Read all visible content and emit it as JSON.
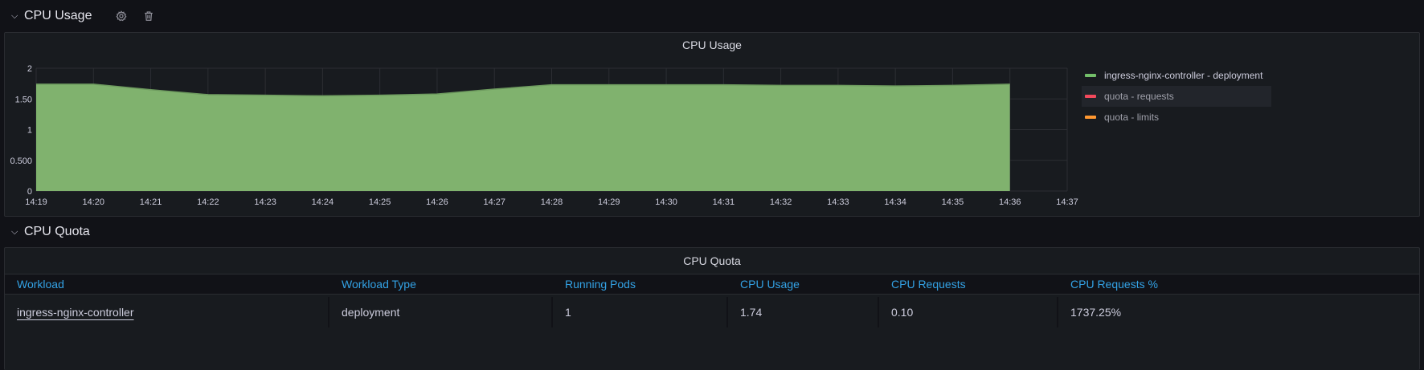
{
  "rows": [
    {
      "title": "CPU Usage"
    },
    {
      "title": "CPU Quota"
    }
  ],
  "usage_panel": {
    "title": "CPU Usage",
    "legend": [
      {
        "label": "ingress-nginx-controller - deployment",
        "color": "#73bf69"
      },
      {
        "label": "quota - requests",
        "color": "#f2495c"
      },
      {
        "label": "quota - limits",
        "color": "#ff9830"
      }
    ]
  },
  "chart_data": {
    "type": "area",
    "title": "CPU Usage",
    "x_ticks": [
      "14:19",
      "14:20",
      "14:21",
      "14:22",
      "14:23",
      "14:24",
      "14:25",
      "14:26",
      "14:27",
      "14:28",
      "14:29",
      "14:30",
      "14:31",
      "14:32",
      "14:33",
      "14:34",
      "14:35",
      "14:36",
      "14:37"
    ],
    "y_ticks": [
      "0",
      "0.500",
      "1",
      "1.50",
      "2"
    ],
    "ylim": [
      0,
      2
    ],
    "grid": true,
    "legend_position": "right",
    "series": [
      {
        "name": "ingress-nginx-controller - deployment",
        "color": "#73bf69",
        "x": [
          "14:19",
          "14:20",
          "14:21",
          "14:22",
          "14:23",
          "14:24",
          "14:25",
          "14:26",
          "14:27",
          "14:28",
          "14:29",
          "14:30",
          "14:31",
          "14:32",
          "14:33",
          "14:34",
          "14:35",
          "14:36"
        ],
        "values": [
          1.74,
          1.74,
          1.65,
          1.57,
          1.56,
          1.55,
          1.56,
          1.58,
          1.66,
          1.73,
          1.73,
          1.73,
          1.73,
          1.72,
          1.72,
          1.71,
          1.72,
          1.74
        ]
      },
      {
        "name": "quota - requests",
        "color": "#f2495c",
        "x": [],
        "values": []
      },
      {
        "name": "quota - limits",
        "color": "#ff9830",
        "x": [],
        "values": []
      }
    ]
  },
  "quota_panel": {
    "title": "CPU Quota",
    "columns": [
      "Workload",
      "Workload Type",
      "Running Pods",
      "CPU Usage",
      "CPU Requests",
      "CPU Requests %"
    ],
    "rows": [
      [
        "ingress-nginx-controller",
        "deployment",
        "1",
        "1.74",
        "0.10",
        "1737.25%"
      ]
    ]
  }
}
